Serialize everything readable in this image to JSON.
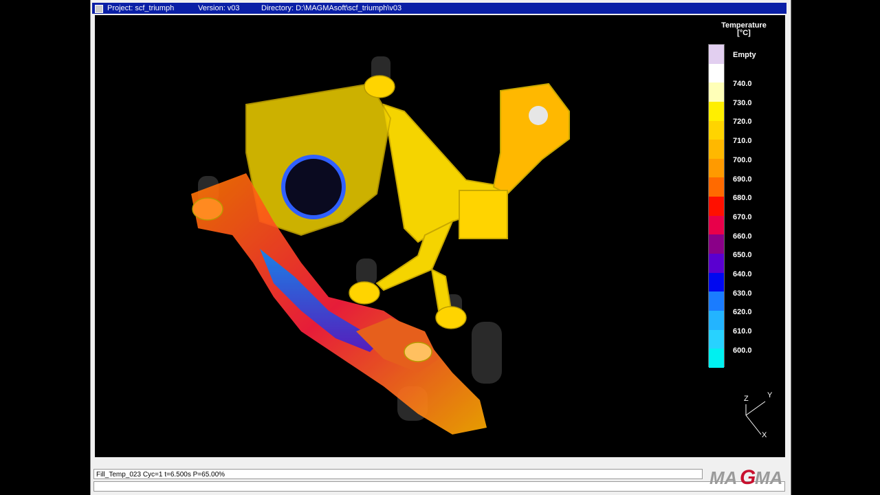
{
  "titlebar": {
    "project": "Project: scf_triumph",
    "version": "Version: v03",
    "directory": "Directory: D:\\MAGMAsoft\\scf_triumph\\v03"
  },
  "legend": {
    "title_line1": "Temperature",
    "title_line2": "[°C]",
    "empty_label": "Empty",
    "labels": [
      "740.0",
      "730.0",
      "720.0",
      "710.0",
      "700.0",
      "690.0",
      "680.0",
      "670.0",
      "660.0",
      "650.0",
      "640.0",
      "630.0",
      "620.0",
      "610.0",
      "600.0"
    ],
    "colors": [
      "#e2cff0",
      "#ffffff",
      "#ffffb8",
      "#ffef00",
      "#ffd400",
      "#ffb800",
      "#ff9a00",
      "#ff6a00",
      "#ff1000",
      "#e8004a",
      "#8a0088",
      "#5a00d0",
      "#0008f0",
      "#1a7cff",
      "#23b4ff",
      "#28d2ff",
      "#00f0f0"
    ]
  },
  "axes": {
    "z": "Z",
    "y": "Y",
    "x": "X"
  },
  "status": {
    "line1": "Fill_Temp_023 Cyc=1 t=6.500s P=65.00%",
    "line2": ""
  },
  "logo": {
    "text": "MAGMA",
    "brand_color": "#c8102e"
  }
}
